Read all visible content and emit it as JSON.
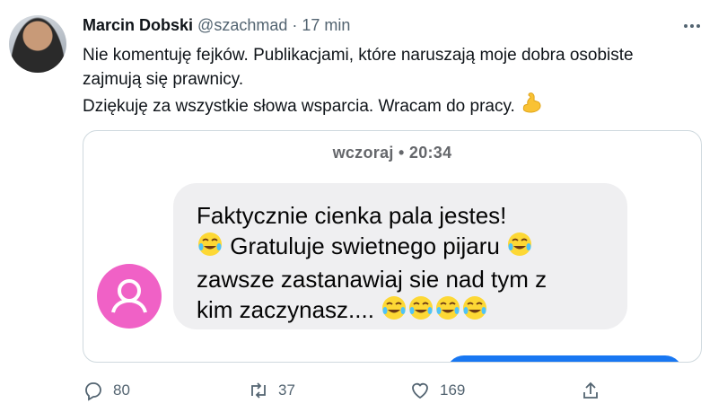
{
  "tweet": {
    "author_name": "Marcin Dobski",
    "handle": "@szachmad",
    "separator": "·",
    "time": "17 min",
    "avatar_icon": "profile-photo",
    "line1": "Nie komentuję fejków. Publikacjami, które naruszają moje dobra osobiste",
    "line2": "zajmują się prawnicy.",
    "line3": "Dziękuję za wszystkie słowa wsparcia. Wracam do pracy.",
    "line3_emoji": "flexed-biceps"
  },
  "media": {
    "timestamp": "wczoraj • 20:34",
    "message_line1": "Faktycznie cienka pala jestes!",
    "message_line2": "Gratuluje swietnego pijaru",
    "message_line3": "zawsze zastanawiaj sie nad tym z",
    "message_line4": "kim zaczynasz....",
    "message_emoji": "face-with-tears-of-joy",
    "avatar_color": "#f061c6"
  },
  "actions": {
    "reply_count": "80",
    "retweet_count": "37",
    "like_count": "169"
  },
  "colors": {
    "text": "#0f1419",
    "secondary": "#536471",
    "border": "#cfd9de",
    "bubble": "#efeff1",
    "messenger_blue": "#1877f2"
  }
}
